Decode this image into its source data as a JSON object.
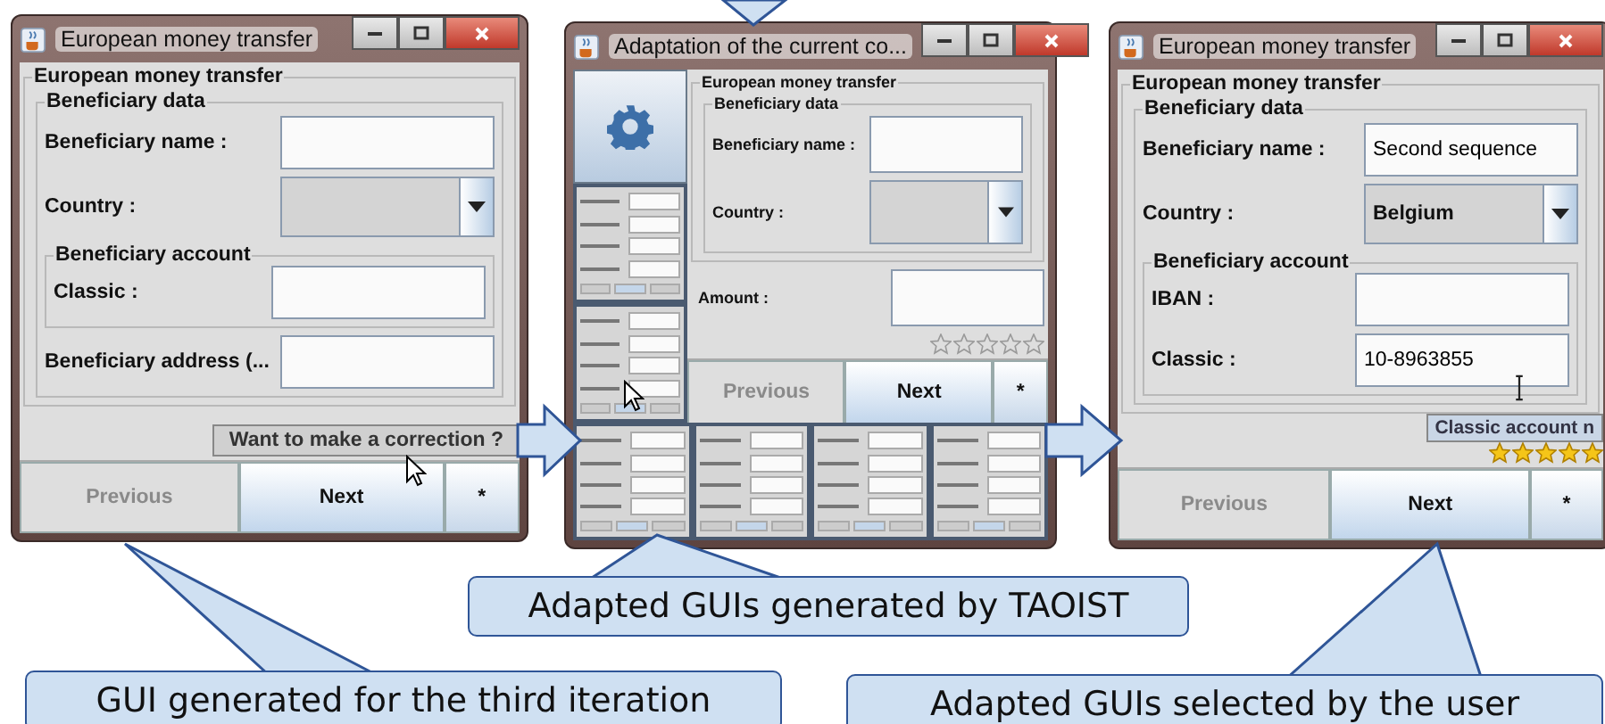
{
  "windows": [
    {
      "title": "European money transfer",
      "kind": "form",
      "form": {
        "title": "European money transfer",
        "section": "Beneficiary data",
        "fields": [
          {
            "kind": "text",
            "label": "Beneficiary name :"
          },
          {
            "kind": "combo",
            "label": "Country :"
          },
          {
            "kind": "group",
            "title": "Beneficiary account",
            "fields": [
              {
                "label": "Classic :"
              }
            ]
          },
          {
            "kind": "text",
            "label": "Beneficiary address (..."
          }
        ]
      },
      "tooltip": "Want to make a correction ?",
      "buttons": [
        {
          "label": "Previous",
          "disabled": true
        },
        {
          "label": "Next",
          "disabled": false
        },
        {
          "label": "*",
          "disabled": false
        }
      ]
    },
    {
      "title": "Adaptation of the current co...",
      "kind": "adaptation",
      "form": {
        "title": "European money transfer",
        "section": "Beneficiary data",
        "fields": [
          {
            "kind": "text",
            "label": "Beneficiary name :"
          },
          {
            "kind": "combo",
            "label": "Country :"
          }
        ]
      },
      "extra_fields": [
        {
          "label": "Amount :"
        }
      ],
      "stars": 0,
      "buttons": [
        {
          "label": "Previous",
          "disabled": true
        },
        {
          "label": "Next",
          "disabled": false
        },
        {
          "label": "*",
          "disabled": false
        }
      ]
    },
    {
      "title": "European money transfer",
      "kind": "form",
      "form": {
        "title": "European money transfer",
        "section": "Beneficiary data",
        "fields": [
          {
            "kind": "text",
            "label": "Beneficiary name :",
            "value": "Second sequence"
          },
          {
            "kind": "combo",
            "label": "Country :",
            "value": "Belgium"
          },
          {
            "kind": "group",
            "title": "Beneficiary account",
            "fields": [
              {
                "label": "IBAN :"
              },
              {
                "label": "Classic :",
                "value": "10-8963855"
              }
            ]
          }
        ]
      },
      "tooltip": "Classic account n",
      "stars": 5,
      "buttons": [
        {
          "label": "Previous",
          "disabled": true
        },
        {
          "label": "Next",
          "disabled": false
        },
        {
          "label": "*",
          "disabled": false
        }
      ]
    }
  ],
  "callouts": [
    {
      "text": "GUI generated for the third iteration"
    },
    {
      "text": "Adapted GUIs generated by TAOIST"
    },
    {
      "text": "Adapted GUIs selected by the user"
    }
  ]
}
